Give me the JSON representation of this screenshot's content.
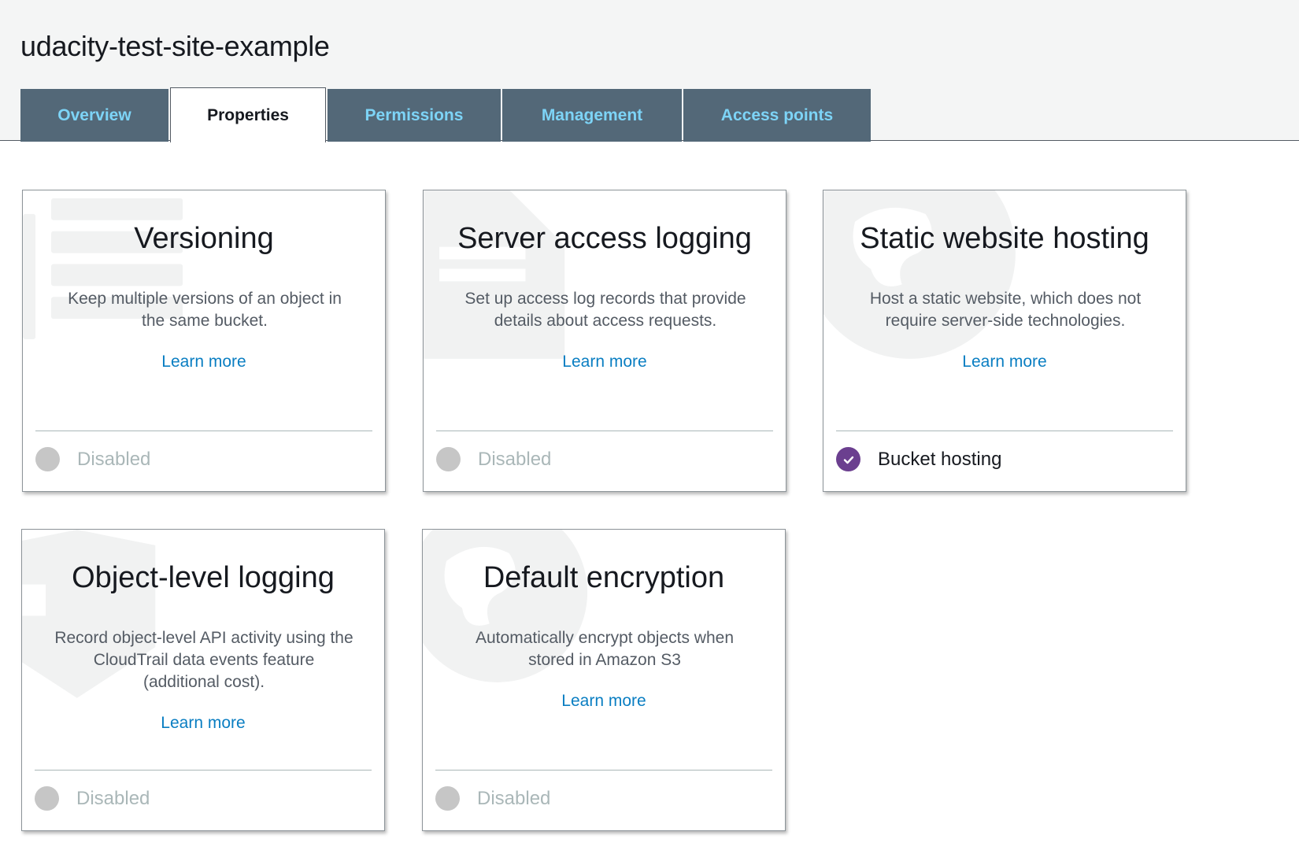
{
  "bucket": {
    "name": "udacity-test-site-example"
  },
  "tabs": [
    {
      "label": "Overview",
      "active": false
    },
    {
      "label": "Properties",
      "active": true
    },
    {
      "label": "Permissions",
      "active": false
    },
    {
      "label": "Management",
      "active": false
    },
    {
      "label": "Access points",
      "active": false
    }
  ],
  "cards": [
    {
      "title": "Versioning",
      "description": "Keep multiple versions of an object in the same bucket.",
      "link": "Learn more",
      "status": "Disabled",
      "enabled": false
    },
    {
      "title": "Server access logging",
      "description": "Set up access log records that provide details about access requests.",
      "link": "Learn more",
      "status": "Disabled",
      "enabled": false
    },
    {
      "title": "Static website hosting",
      "description": "Host a static website, which does not require server-side technologies.",
      "link": "Learn more",
      "status": "Bucket hosting",
      "enabled": true
    },
    {
      "title": "Object-level logging",
      "description": "Record object-level API activity using the CloudTrail data events feature (additional cost).",
      "link": "Learn more",
      "status": "Disabled",
      "enabled": false
    },
    {
      "title": "Default encryption",
      "description": "Automatically encrypt objects when stored in Amazon S3",
      "link": "Learn more",
      "status": "Disabled",
      "enabled": false
    }
  ],
  "colors": {
    "tab_background": "#536878",
    "tab_text": "#7dd4f7",
    "link": "#0a7ec2",
    "enabled_check": "#6b3f8f",
    "disabled_dot": "#c6c6c6"
  }
}
